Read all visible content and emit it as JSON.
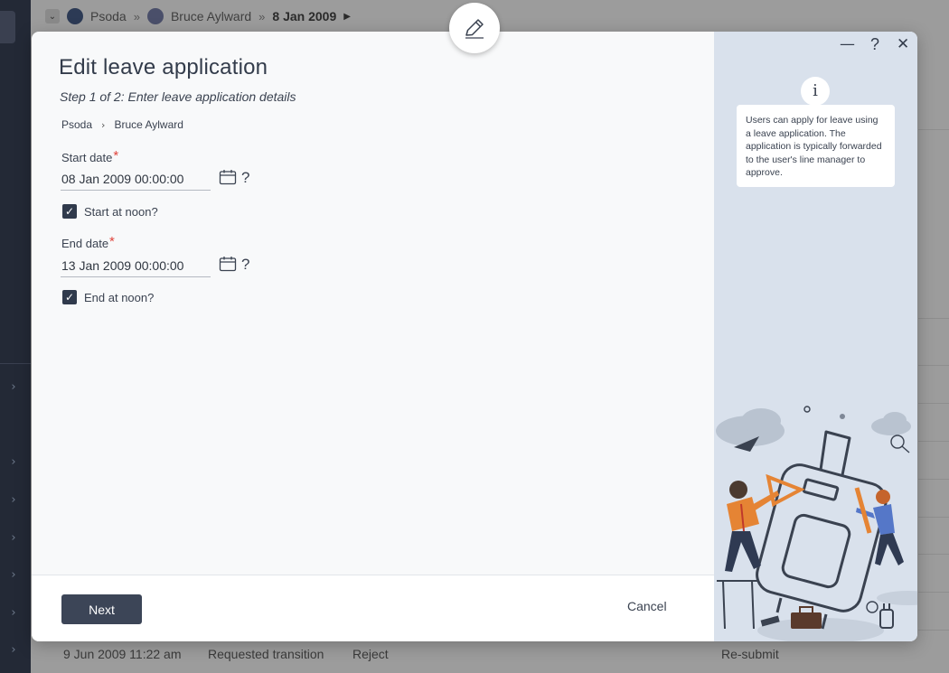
{
  "background": {
    "breadcrumb": {
      "root": "Psoda",
      "user": "Bruce Aylward",
      "date": "8 Jan 2009"
    },
    "bottom_row": {
      "datetime": "9 Jun 2009 11:22 am",
      "event": "Requested transition",
      "action": "Reject",
      "next": "Re-submit"
    }
  },
  "modal": {
    "title": "Edit leave application",
    "subtitle": "Step 1 of 2: Enter leave application details",
    "breadcrumb": {
      "root": "Psoda",
      "user": "Bruce Aylward"
    },
    "start_date": {
      "label": "Start date",
      "required_mark": "*",
      "value": "08 Jan 2009 00:00:00",
      "help": "?"
    },
    "start_at_noon": {
      "label": "Start at noon?",
      "checked": true
    },
    "end_date": {
      "label": "End date",
      "required_mark": "*",
      "value": "13 Jan 2009 00:00:00",
      "help": "?"
    },
    "end_at_noon": {
      "label": "End at noon?",
      "checked": true
    },
    "footer": {
      "next_label": "Next",
      "cancel_label": "Cancel"
    },
    "window_controls": {
      "minimize": "—",
      "help": "?",
      "close": "✕"
    },
    "info": {
      "icon_label": "i",
      "text": "Users can apply for leave using a leave application. The application is typically forwarded to the user's line manager to approve."
    },
    "icons": {
      "edit": "pencil-icon",
      "calendar": "calendar-icon",
      "checkbox_mark": "✓"
    }
  },
  "colors": {
    "primary_button": "#3c4557",
    "side_panel": "#d9e1ec",
    "required": "#e0453d",
    "overlay": "#9c9c9c"
  }
}
